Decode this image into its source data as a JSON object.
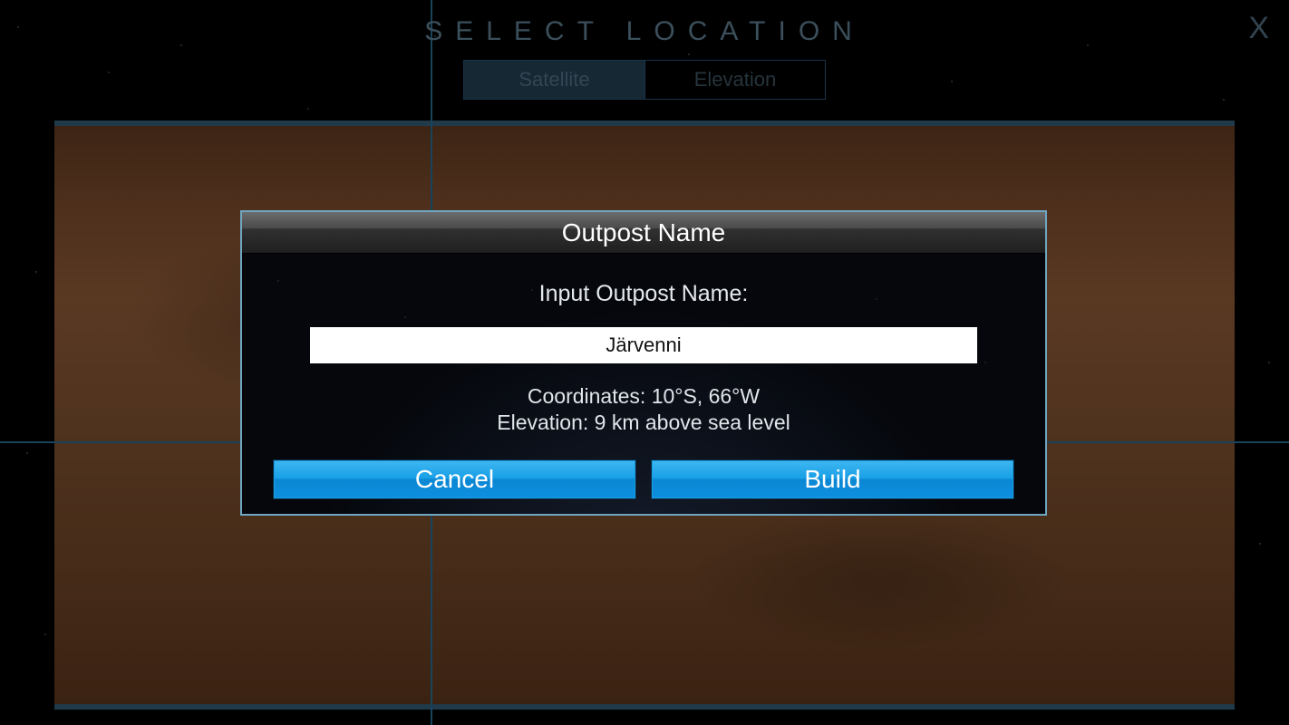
{
  "header": {
    "title": "SELECT LOCATION",
    "close_label": "X",
    "tabs": [
      {
        "label": "Satellite",
        "active": true
      },
      {
        "label": "Elevation",
        "active": false
      }
    ]
  },
  "dialog": {
    "title": "Outpost Name",
    "prompt": "Input Outpost Name:",
    "name_value": "Järvenni",
    "coordinates_line": "Coordinates: 10°S, 66°W",
    "elevation_line": "Elevation: 9 km above sea level",
    "cancel_label": "Cancel",
    "build_label": "Build"
  }
}
